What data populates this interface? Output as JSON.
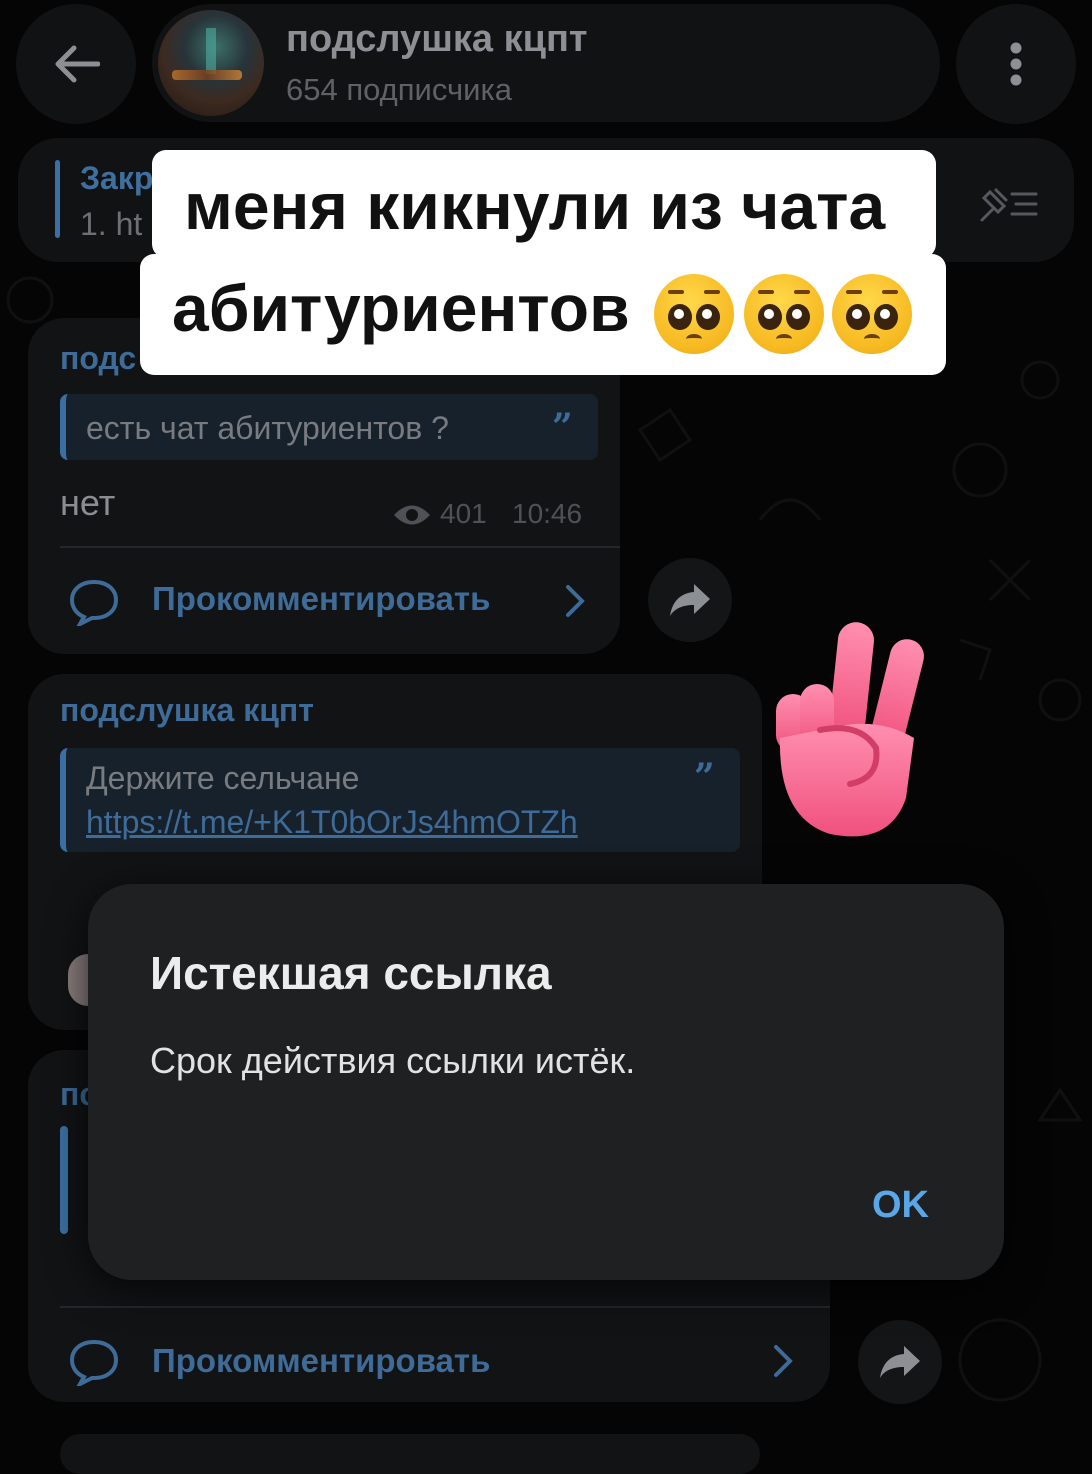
{
  "header": {
    "channel_title": "подслушка кцпт",
    "subscribers": "654 подписчика"
  },
  "pinned": {
    "title": "Закр",
    "text": "1. ht"
  },
  "caption": {
    "line1": "меня кикнули из чата",
    "line2": "абитуриентов"
  },
  "messages": [
    {
      "sender": "подс",
      "quote": "есть чат абитуриентов ?",
      "text": "нет",
      "views": "401",
      "time": "10:46",
      "comment_label": "Прокомментировать"
    },
    {
      "sender": "подслушка кцпт",
      "quote_line1": "Держите сельчане",
      "quote_link": "https://t.me/+K1T0bOrJs4hmOTZh",
      "comment_label": "Прокомментировать",
      "next_sender_partial": "пс"
    }
  ],
  "dialog": {
    "title": "Истекшая ссылка",
    "body": "Срок действия ссылки истёк.",
    "ok_label": "OK"
  },
  "colors": {
    "background": "#050505",
    "bubble": "#121315",
    "accent": "#3e6b97",
    "dialog": "#1f2021",
    "dialog_ok": "#5aa6e6",
    "caption_bg": "#ffffff"
  },
  "icons": [
    "back-arrow-icon",
    "more-vert-icon",
    "pinned-list-icon",
    "eye-icon",
    "comment-bubble-icon",
    "chevron-right-icon",
    "share-arrow-icon",
    "pleading-face-emoji",
    "victory-hand-emoji"
  ]
}
